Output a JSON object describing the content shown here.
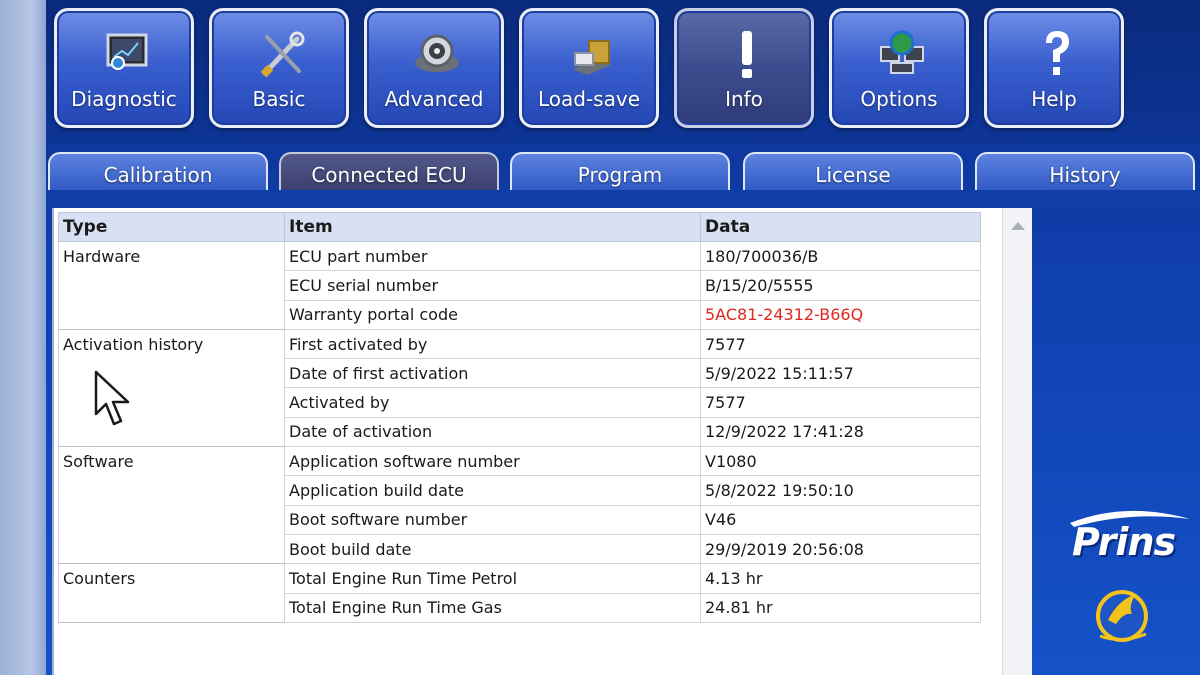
{
  "toolbar": {
    "buttons": [
      {
        "label": "Diagnostic",
        "icon": "monitor-icon"
      },
      {
        "label": "Basic",
        "icon": "tools-icon"
      },
      {
        "label": "Advanced",
        "icon": "gauge-icon"
      },
      {
        "label": "Load-save",
        "icon": "disk-icon"
      },
      {
        "label": "Info",
        "icon": "exclamation-icon",
        "active": true
      },
      {
        "label": "Options",
        "icon": "globe-computer-icon"
      },
      {
        "label": "Help",
        "icon": "question-icon"
      }
    ]
  },
  "tabs": [
    {
      "label": "Calibration"
    },
    {
      "label": "Connected ECU",
      "active": true
    },
    {
      "label": "Program"
    },
    {
      "label": "License"
    },
    {
      "label": "History"
    }
  ],
  "table": {
    "headers": [
      "Type",
      "Item",
      "Data"
    ],
    "groups": [
      {
        "type": "Hardware",
        "rows": [
          {
            "item": "ECU part number",
            "data": "180/700036/B"
          },
          {
            "item": "ECU serial number",
            "data": "B/15/20/5555"
          },
          {
            "item": "Warranty portal code",
            "data": "5AC81-24312-B66Q",
            "highlight": "#e0261f"
          }
        ]
      },
      {
        "type": "Activation history",
        "rows": [
          {
            "item": "First activated by",
            "data": "7577"
          },
          {
            "item": "Date of first activation",
            "data": "5/9/2022 15:11:57"
          },
          {
            "item": "Activated by",
            "data": "7577"
          },
          {
            "item": "Date of activation",
            "data": "12/9/2022 17:41:28"
          }
        ]
      },
      {
        "type": "Software",
        "rows": [
          {
            "item": "Application software number",
            "data": "V1080"
          },
          {
            "item": "Application build date",
            "data": "5/8/2022 19:50:10"
          },
          {
            "item": "Boot software number",
            "data": "V46"
          },
          {
            "item": "Boot build date",
            "data": "29/9/2019 20:56:08"
          }
        ]
      },
      {
        "type": "Counters",
        "rows": [
          {
            "item": "Total Engine Run Time Petrol",
            "data": "4.13 hr"
          },
          {
            "item": "Total Engine Run Time Gas",
            "data": "24.81 hr"
          }
        ]
      }
    ]
  },
  "brand": {
    "name": "Prins",
    "color": "#ffffff",
    "accent": "#f2c31b"
  },
  "colors": {
    "background": "#0d3fa8",
    "button": "#3a5fcf",
    "header_row": "#d7e1f3"
  }
}
